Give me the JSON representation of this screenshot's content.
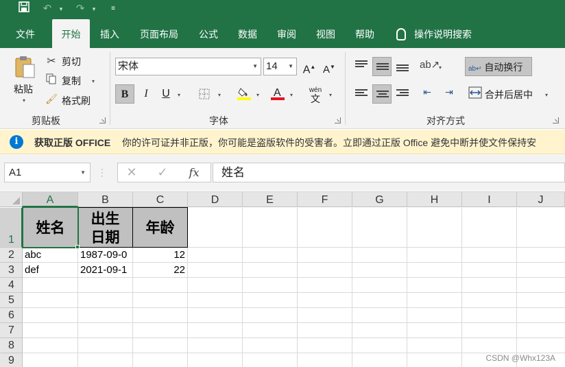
{
  "qat": {
    "save": "save-icon",
    "undo": "undo-icon",
    "redo": "redo-icon",
    "customize": "customize-icon"
  },
  "tabs": [
    {
      "label": "文件",
      "active": false
    },
    {
      "label": "开始",
      "active": true
    },
    {
      "label": "插入",
      "active": false
    },
    {
      "label": "页面布局",
      "active": false
    },
    {
      "label": "公式",
      "active": false
    },
    {
      "label": "数据",
      "active": false
    },
    {
      "label": "审阅",
      "active": false
    },
    {
      "label": "视图",
      "active": false
    },
    {
      "label": "帮助",
      "active": false
    }
  ],
  "help_search": "操作说明搜索",
  "ribbon": {
    "clipboard": {
      "paste": "粘贴",
      "cut": "剪切",
      "copy": "复制",
      "format_painter": "格式刷",
      "group": "剪贴板"
    },
    "font": {
      "family": "宋体",
      "size": "14",
      "group": "字体",
      "bold": "B",
      "italic": "I",
      "underline": "U",
      "font_color": "#e81123",
      "fill_color": "#ffff00"
    },
    "alignment": {
      "wrap_text": "自动换行",
      "merge_center": "合并后居中",
      "group": "对齐方式"
    }
  },
  "infobar": {
    "title": "获取正版 OFFICE",
    "message": "你的许可证并非正版，你可能是盗版软件的受害者。立即通过正版 Office 避免中断并使文件保持安"
  },
  "formula_bar": {
    "name_box": "A1",
    "fx": "fx",
    "content": "姓名"
  },
  "sheet": {
    "columns": [
      "A",
      "B",
      "C",
      "D",
      "E",
      "F",
      "G",
      "H",
      "I",
      "J"
    ],
    "rows": [
      "1",
      "2",
      "3",
      "4",
      "5",
      "6",
      "7",
      "8",
      "9"
    ],
    "cells": {
      "A1": "姓名",
      "B1": "出生日期",
      "C1": "年龄",
      "A2": "abc",
      "B2": "1987-09-0",
      "C2": "12",
      "A3": "def",
      "B3": "2021-09-1",
      "C3": "22"
    },
    "active_cell": "A1"
  },
  "watermark": "CSDN @Whx123A",
  "colors": {
    "accent": "#217346",
    "header_fill": "#c0c0c0",
    "infobar": "#fff4ce"
  }
}
